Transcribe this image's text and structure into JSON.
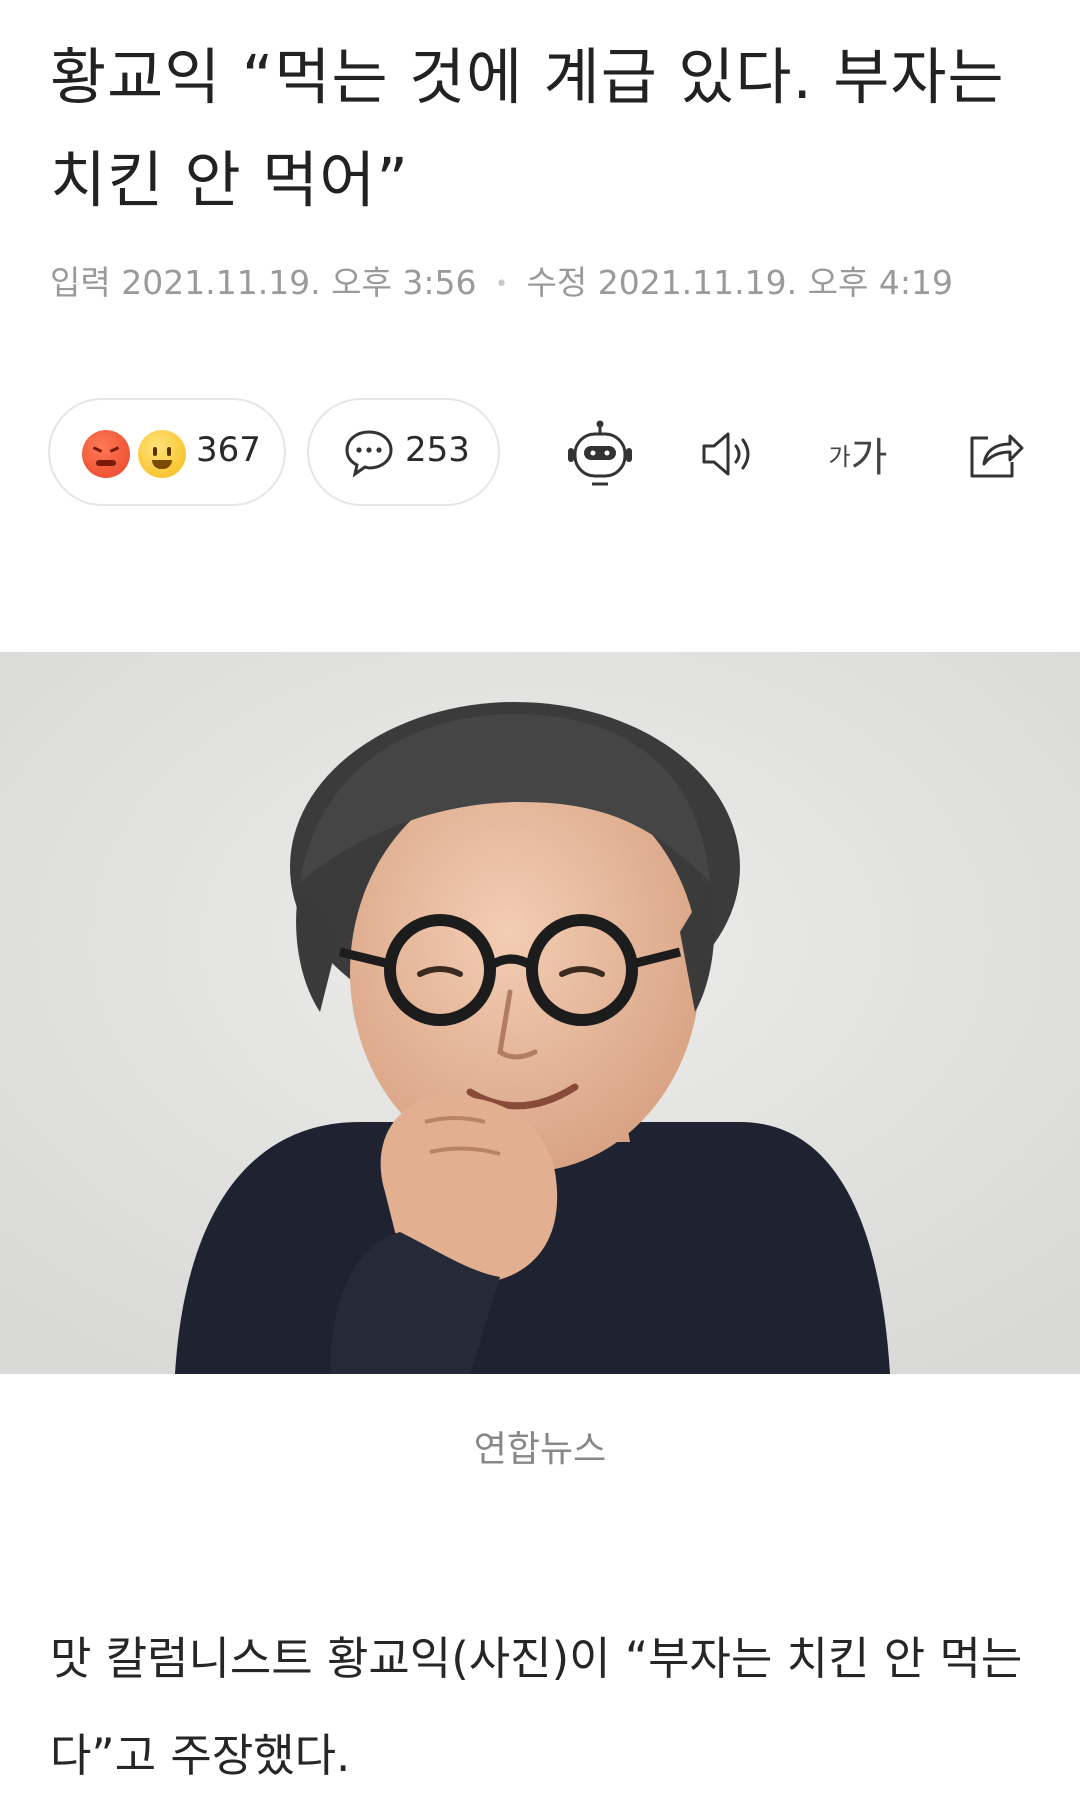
{
  "article": {
    "headline": "황교익 “먹는 것에 계급 있다. 부자는 치킨 안 먹어”",
    "meta": {
      "published_label": "입력",
      "published_time": "2021.11.19. 오후 3:56",
      "separator": "•",
      "modified_label": "수정",
      "modified_time": "2021.11.19. 오후 4:19"
    },
    "image_caption": "연합뉴스",
    "body_paragraph": "맛 칼럼니스트 황교익(사진)이 “부자는 치킨 안 먹는다”고 주장했다."
  },
  "toolbar": {
    "reactions": {
      "icons": [
        "angry-emoji-icon",
        "laughing-emoji-icon"
      ],
      "count": "367"
    },
    "comments": {
      "icon": "speech-bubble-icon",
      "count": "253"
    },
    "summary_bot": {
      "icon": "robot-icon"
    },
    "text_to_speech": {
      "icon": "speaker-icon"
    },
    "font_size": {
      "small": "가",
      "big": "가"
    },
    "share": {
      "icon": "share-icon"
    }
  },
  "colors": {
    "meta_gray": "#9a9a9a",
    "pill_border": "#e6e6e6",
    "angry_emoji": "#e8442a",
    "laugh_emoji": "#f7b916"
  }
}
